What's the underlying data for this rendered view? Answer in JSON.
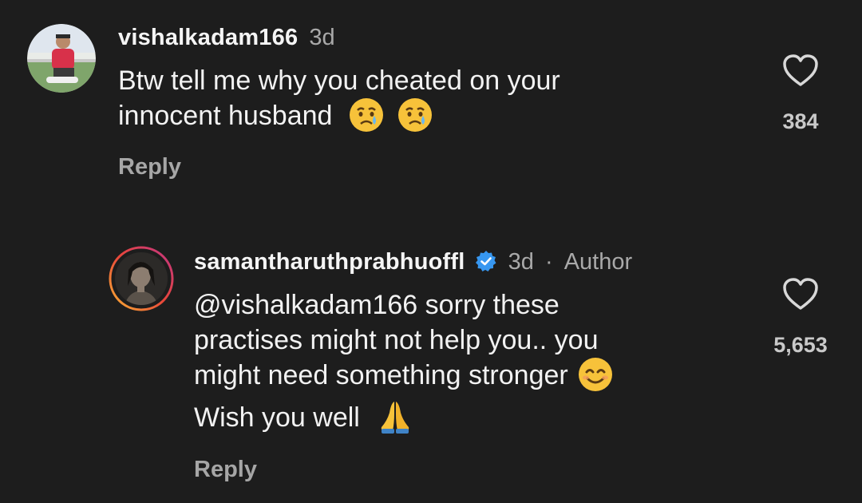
{
  "comments": [
    {
      "username": "vishalkadam166",
      "time": "3d",
      "lines": [
        "Btw tell me why you cheated on your",
        "innocent husband"
      ],
      "emoji": [
        "crying-face",
        "crying-face"
      ],
      "reply_label": "Reply",
      "likes": "384"
    },
    {
      "username": "samantharuthprabhuoffl",
      "verified": true,
      "time": "3d",
      "separator": "·",
      "author_label": "Author",
      "lines": [
        "@vishalkadam166 sorry these",
        "practises might not help you.. you",
        "might need something stronger",
        "Wish you well"
      ],
      "emoji": [
        "smiling-face",
        "folded-hands"
      ],
      "reply_label": "Reply",
      "likes": "5,653"
    }
  ],
  "colors": {
    "background": "#1d1d1d",
    "text": "#f2f2f2",
    "muted": "#a9a9a9",
    "verified_blue": "#3797f0",
    "story_ring_start": "#f9b233",
    "story_ring_end": "#c13584"
  }
}
